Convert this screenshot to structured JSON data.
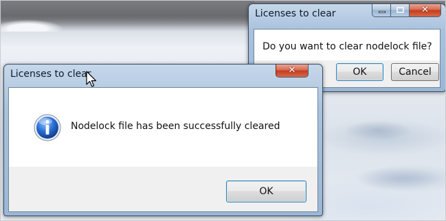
{
  "desktop": {
    "background_description": "snowy landscape wallpaper"
  },
  "confirm_dialog": {
    "title": "Licenses to clear",
    "message": "Do you want to clear nodelock file?",
    "ok_label": "OK",
    "cancel_label": "Cancel",
    "caption_buttons": [
      "minimize",
      "maximize",
      "close"
    ]
  },
  "info_dialog": {
    "title": "Licenses to clear",
    "icon": "information-icon",
    "message": "Nodelock file has been successfully cleared",
    "ok_label": "OK",
    "close_glyph": "✕"
  },
  "colors": {
    "title_bar": "#a9c2dd",
    "close_button": "#c43c1c",
    "info_icon_blue": "#1f5fc0",
    "default_button_border": "#3c7fb1"
  }
}
